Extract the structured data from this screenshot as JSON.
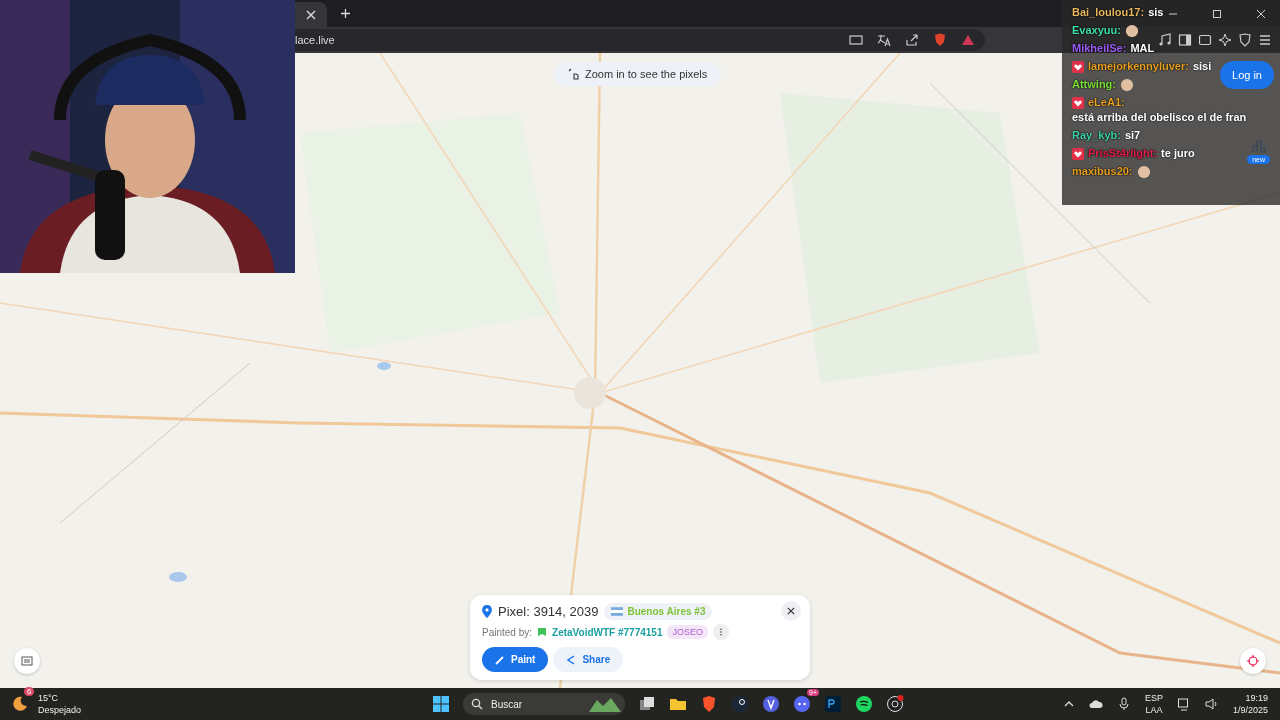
{
  "browser": {
    "address": "lace.live"
  },
  "page": {
    "zoom_hint": "Zoom in to see the pixels",
    "login": "Log in",
    "leaderboard_badge": "new",
    "pixel_panel": {
      "pixel": "Pixel: 3914, 2039",
      "region": "Buenos Aires #3",
      "painted_by_label": "Painted by:",
      "painter": "ZetaVoidWTF #7774151",
      "tag": "JOSEO",
      "buttons": [
        {
          "label": "Paint",
          "kind": "primary"
        },
        {
          "label": "Share",
          "kind": "secondary"
        }
      ]
    }
  },
  "chat": [
    {
      "user": "Bai_loulou17:",
      "color": "#e8b860",
      "badge": false,
      "text": "sis"
    },
    {
      "user": "Evaxyuu:",
      "color": "#3de0a8",
      "badge": false,
      "emote": true
    },
    {
      "user": "MikheilSe:",
      "color": "#9b5cf6",
      "badge": false,
      "text": "MAL"
    },
    {
      "user": "lamejorkennyluver:",
      "color": "#e8a020",
      "badge": true,
      "text": "sisi"
    },
    {
      "user": "Attwing:",
      "color": "#7ee03a",
      "badge": false,
      "emote": true
    },
    {
      "user": "eLeA1:",
      "color": "#e8a020",
      "badge": true,
      "text": "está arriba del obelisco el de fran"
    },
    {
      "user": "Ray_kyb:",
      "color": "#40d0a8",
      "badge": false,
      "text": "si7"
    },
    {
      "user": "PrisSt4rlight:",
      "color": "#e0204a",
      "badge": true,
      "text": "te juro"
    },
    {
      "user": "maxibus20:",
      "color": "#e8a020",
      "badge": false,
      "emote": true
    }
  ],
  "taskbar": {
    "weather_badge": "6",
    "temperature": "15°C",
    "condition": "Despejado",
    "search_placeholder": "Buscar",
    "discord_badge": "9+",
    "language": "ESP",
    "layout": "LAA",
    "time": "19:19",
    "date": "1/9/2025"
  }
}
